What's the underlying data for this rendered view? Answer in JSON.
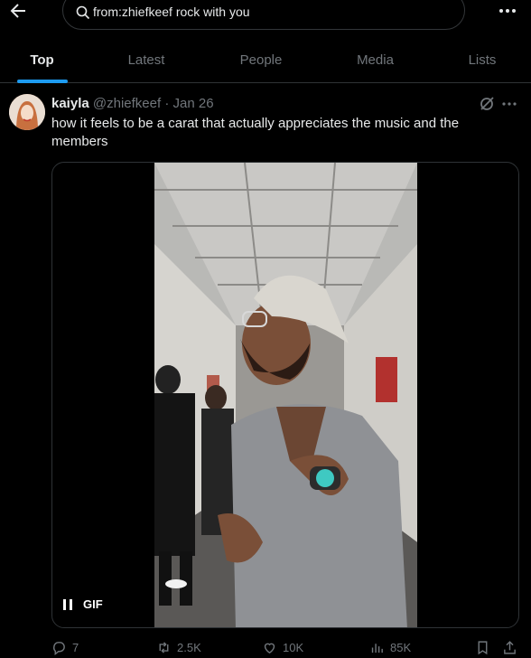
{
  "search": {
    "query": "from:zhiefkeef rock with you"
  },
  "tabs": [
    {
      "label": "Top",
      "active": true
    },
    {
      "label": "Latest",
      "active": false
    },
    {
      "label": "People",
      "active": false
    },
    {
      "label": "Media",
      "active": false
    },
    {
      "label": "Lists",
      "active": false
    }
  ],
  "tweet": {
    "display_name": "kaiyla",
    "handle": "@zhiefkeef",
    "separator": "·",
    "date": "Jan 26",
    "text": "how it feels to be a carat that actually appreciates the music and the members",
    "media": {
      "type_label": "GIF"
    },
    "stats": {
      "replies": "7",
      "reposts": "2.5K",
      "likes": "10K",
      "views": "85K"
    }
  },
  "colors": {
    "background": "#000000",
    "accent": "#1d9bf0",
    "text_primary": "#e7e9ea",
    "text_secondary": "#71767b",
    "border": "#2f3336"
  },
  "icons": [
    "back-arrow-icon",
    "search-icon",
    "more-icon",
    "grok-icon",
    "pause-icon",
    "reply-icon",
    "repost-icon",
    "like-icon",
    "views-icon",
    "bookmark-icon",
    "share-icon"
  ]
}
